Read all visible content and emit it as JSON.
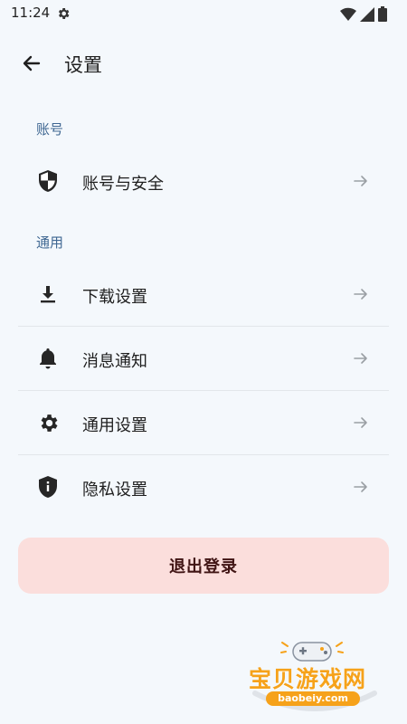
{
  "status_bar": {
    "time": "11:24"
  },
  "header": {
    "title": "设置"
  },
  "sections": [
    {
      "label": "账号",
      "items": [
        {
          "label": "账号与安全",
          "icon": "shield-icon"
        }
      ]
    },
    {
      "label": "通用",
      "items": [
        {
          "label": "下载设置",
          "icon": "download-icon"
        },
        {
          "label": "消息通知",
          "icon": "bell-icon"
        },
        {
          "label": "通用设置",
          "icon": "gear-icon"
        },
        {
          "label": "隐私设置",
          "icon": "privacy-shield-icon"
        }
      ]
    }
  ],
  "logout": {
    "label": "退出登录"
  },
  "watermark": {
    "text": "宝贝游戏网",
    "url": "baobeiy.com"
  },
  "colors": {
    "background": "#f4f8fc",
    "section_label": "#3f6792",
    "logout_bg": "#fbdedc",
    "logout_text": "#401414",
    "watermark": "#f6a21a"
  }
}
